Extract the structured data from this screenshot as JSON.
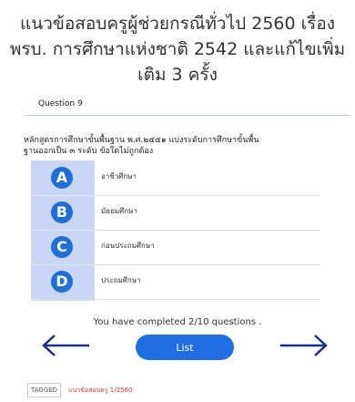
{
  "page": {
    "title_lines": [
      "แนวข้อสอบครูผู้ช่วยกรณีทั่วไป 2560 เรื่อง",
      "พรบ. การศึกษาแห่งชาติ 2542 และแก้ไขเพิ่ม",
      "เติม 3 ครั้ง"
    ]
  },
  "quiz": {
    "question_label": "Question 9",
    "question_lines": [
      "หลักสูตรการศึกษาขั้นพื้นฐาน พ.ศ.๒๕๕๑ แบ่งระดับการศึกษาขั้นพื้น",
      "ฐานออกเป็น ๓ ระดับ ข้อใดไม่ถูกต้อง"
    ],
    "options": [
      {
        "letter": "A",
        "text": "อาชีวศึกษา"
      },
      {
        "letter": "B",
        "text": "มัธยมศึกษา"
      },
      {
        "letter": "C",
        "text": "ก่อนประถมศึกษา"
      },
      {
        "letter": "D",
        "text": "ประถมศึกษา"
      }
    ],
    "status": "You have completed 2/10 questions .",
    "list_button": "List",
    "prev_icon": "arrow-left-icon",
    "next_icon": "arrow-right-icon"
  },
  "footer": {
    "tagged_label": "TAGGED",
    "tag": "แนวข้อสอบครู 1/2560"
  },
  "colors": {
    "accent": "#1f6fe2",
    "option_column": "#c9d7f5",
    "tag_link": "#d03c2c",
    "header_line": "#b8d4ee"
  }
}
